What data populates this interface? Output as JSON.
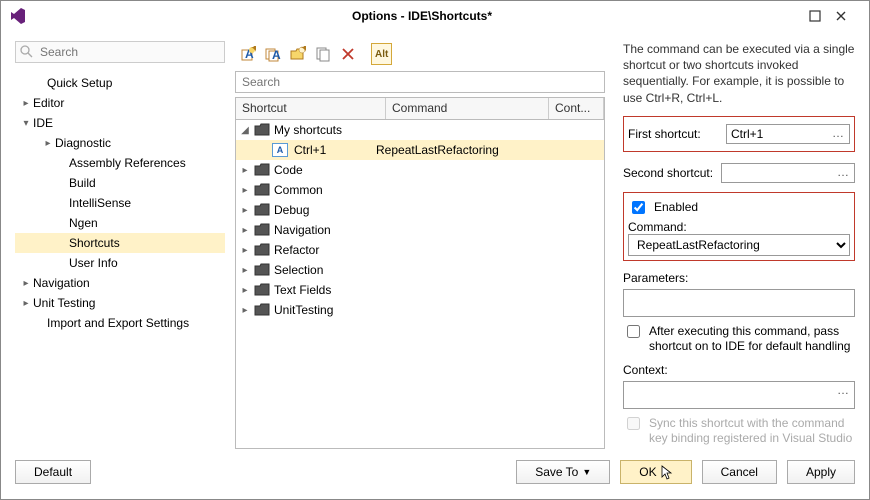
{
  "window": {
    "title": "Options - IDE\\Shortcuts*"
  },
  "leftSearch": {
    "placeholder": "Search"
  },
  "tree": {
    "items": [
      {
        "label": "Quick Setup",
        "indent": 20,
        "caret": ""
      },
      {
        "label": "Editor",
        "indent": 6,
        "caret": "▸"
      },
      {
        "label": "IDE",
        "indent": 6,
        "caret": "▾"
      },
      {
        "label": "Diagnostic",
        "indent": 28,
        "caret": "▸"
      },
      {
        "label": "Assembly References",
        "indent": 42,
        "caret": ""
      },
      {
        "label": "Build",
        "indent": 42,
        "caret": ""
      },
      {
        "label": "IntelliSense",
        "indent": 42,
        "caret": ""
      },
      {
        "label": "Ngen",
        "indent": 42,
        "caret": ""
      },
      {
        "label": "Shortcuts",
        "indent": 42,
        "caret": "",
        "selected": true
      },
      {
        "label": "User Info",
        "indent": 42,
        "caret": ""
      },
      {
        "label": "Navigation",
        "indent": 6,
        "caret": "▸"
      },
      {
        "label": "Unit Testing",
        "indent": 6,
        "caret": "▸"
      },
      {
        "label": "Import and Export Settings",
        "indent": 20,
        "caret": ""
      }
    ]
  },
  "midSearch": {
    "placeholder": "Search"
  },
  "gridHeaders": {
    "shortcut": "Shortcut",
    "command": "Command",
    "context": "Cont..."
  },
  "folders": [
    {
      "label": "My shortcuts",
      "expanded": true,
      "children": [
        {
          "shortcut": "Ctrl+1",
          "command": "RepeatLastRefactoring",
          "selected": true
        }
      ]
    },
    {
      "label": "Code",
      "expanded": false
    },
    {
      "label": "Common",
      "expanded": false
    },
    {
      "label": "Debug",
      "expanded": false
    },
    {
      "label": "Navigation",
      "expanded": false
    },
    {
      "label": "Refactor",
      "expanded": false
    },
    {
      "label": "Selection",
      "expanded": false
    },
    {
      "label": "Text Fields",
      "expanded": false
    },
    {
      "label": "UnitTesting",
      "expanded": false
    }
  ],
  "right": {
    "description": "The command can be executed via a single shortcut or two shortcuts invoked sequentially. For example, it is possible to use Ctrl+R, Ctrl+L.",
    "firstShortcutLabel": "First shortcut:",
    "firstShortcutValue": "Ctrl+1",
    "secondShortcutLabel": "Second shortcut:",
    "secondShortcutValue": "",
    "enabledLabel": "Enabled",
    "enabledChecked": true,
    "commandLabel": "Command:",
    "commandValue": "RepeatLastRefactoring",
    "parametersLabel": "Parameters:",
    "parametersValue": "",
    "passThroughLabel": "After executing this command, pass shortcut on to IDE for default handling",
    "passThroughChecked": false,
    "contextLabel": "Context:",
    "contextValue": "",
    "syncLabel": "Sync this shortcut with the command key binding registered in Visual Studio",
    "syncChecked": false
  },
  "toolbar": {
    "altLabel": "Alt"
  },
  "footer": {
    "default": "Default",
    "saveTo": "Save To",
    "ok": "OK",
    "cancel": "Cancel",
    "apply": "Apply"
  }
}
